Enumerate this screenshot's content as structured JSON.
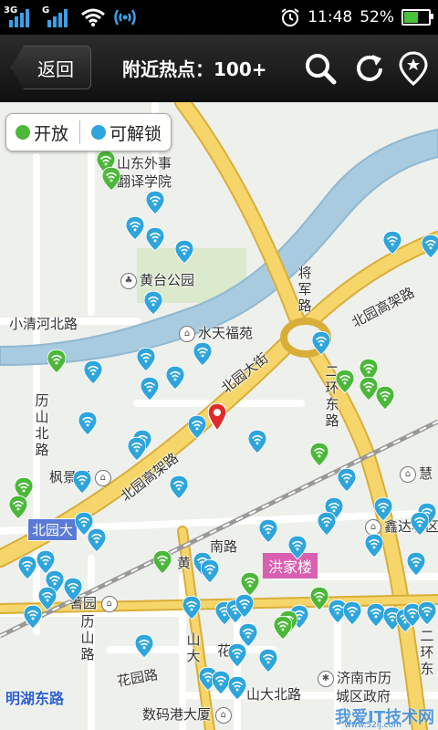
{
  "status_bar": {
    "sim1_tag": "3G",
    "sim2_tag": "G",
    "time": "11:48",
    "battery": "52%",
    "battery_level": 0.52,
    "icons": [
      "signal-3g-icon",
      "signal-g-icon",
      "wifi-icon",
      "hotspot-icon",
      "alarm-icon",
      "battery-icon"
    ]
  },
  "header": {
    "back_label": "返回",
    "title": "附近热点：100+",
    "icons": [
      "search-icon",
      "refresh-icon",
      "locate-icon"
    ]
  },
  "legend": {
    "open_label": "开放",
    "unlockable_label": "可解锁",
    "open_color": "#4cb83a",
    "unlockable_color": "#2ea5dc"
  },
  "map": {
    "labels": {
      "shandong": "山东外事",
      "fanyi": "翻译学院",
      "huangtai": "黄台公园",
      "xiaoqinghe": "小清河北路",
      "shuitian": "水天福苑",
      "jiangjun": "将军路",
      "beiyuan_gaojia_ne": "北园高架路",
      "beiyuan_dajie": "北园大街",
      "erhuan_dong": "二环东路",
      "lishan_bei": "历山北路",
      "fengjing": "枫景园",
      "beiyuan_gaojia_sw": "北园高架路",
      "beiyuan_da": "北园大",
      "huanghe_nanlu": "黄",
      "nanlu": "南路",
      "hongjialou": "洪家楼",
      "xinda": "鑫达小区",
      "hui": "慧",
      "shuyuan": "蓍园",
      "lishanlu": "历山路",
      "huayuanlu": "花园路",
      "shanda": "山大",
      "huayuan2": "花",
      "shandabeilu": "山大北路",
      "jinan": "济南市历",
      "chengqu": "城区政府",
      "shuma": "数码港大厦",
      "erhuan_dong2": "二环东",
      "minghu": "明湖东路"
    },
    "watermark": "我爱IT技术网",
    "watermark_url": "www.52ij.com"
  },
  "colors": {
    "road_yellow": "#f6d66a",
    "road_border": "#d9ae38",
    "river": "#a8cbe0",
    "park_green": "#c9dfb5",
    "pin_red": "#e02a2a"
  }
}
